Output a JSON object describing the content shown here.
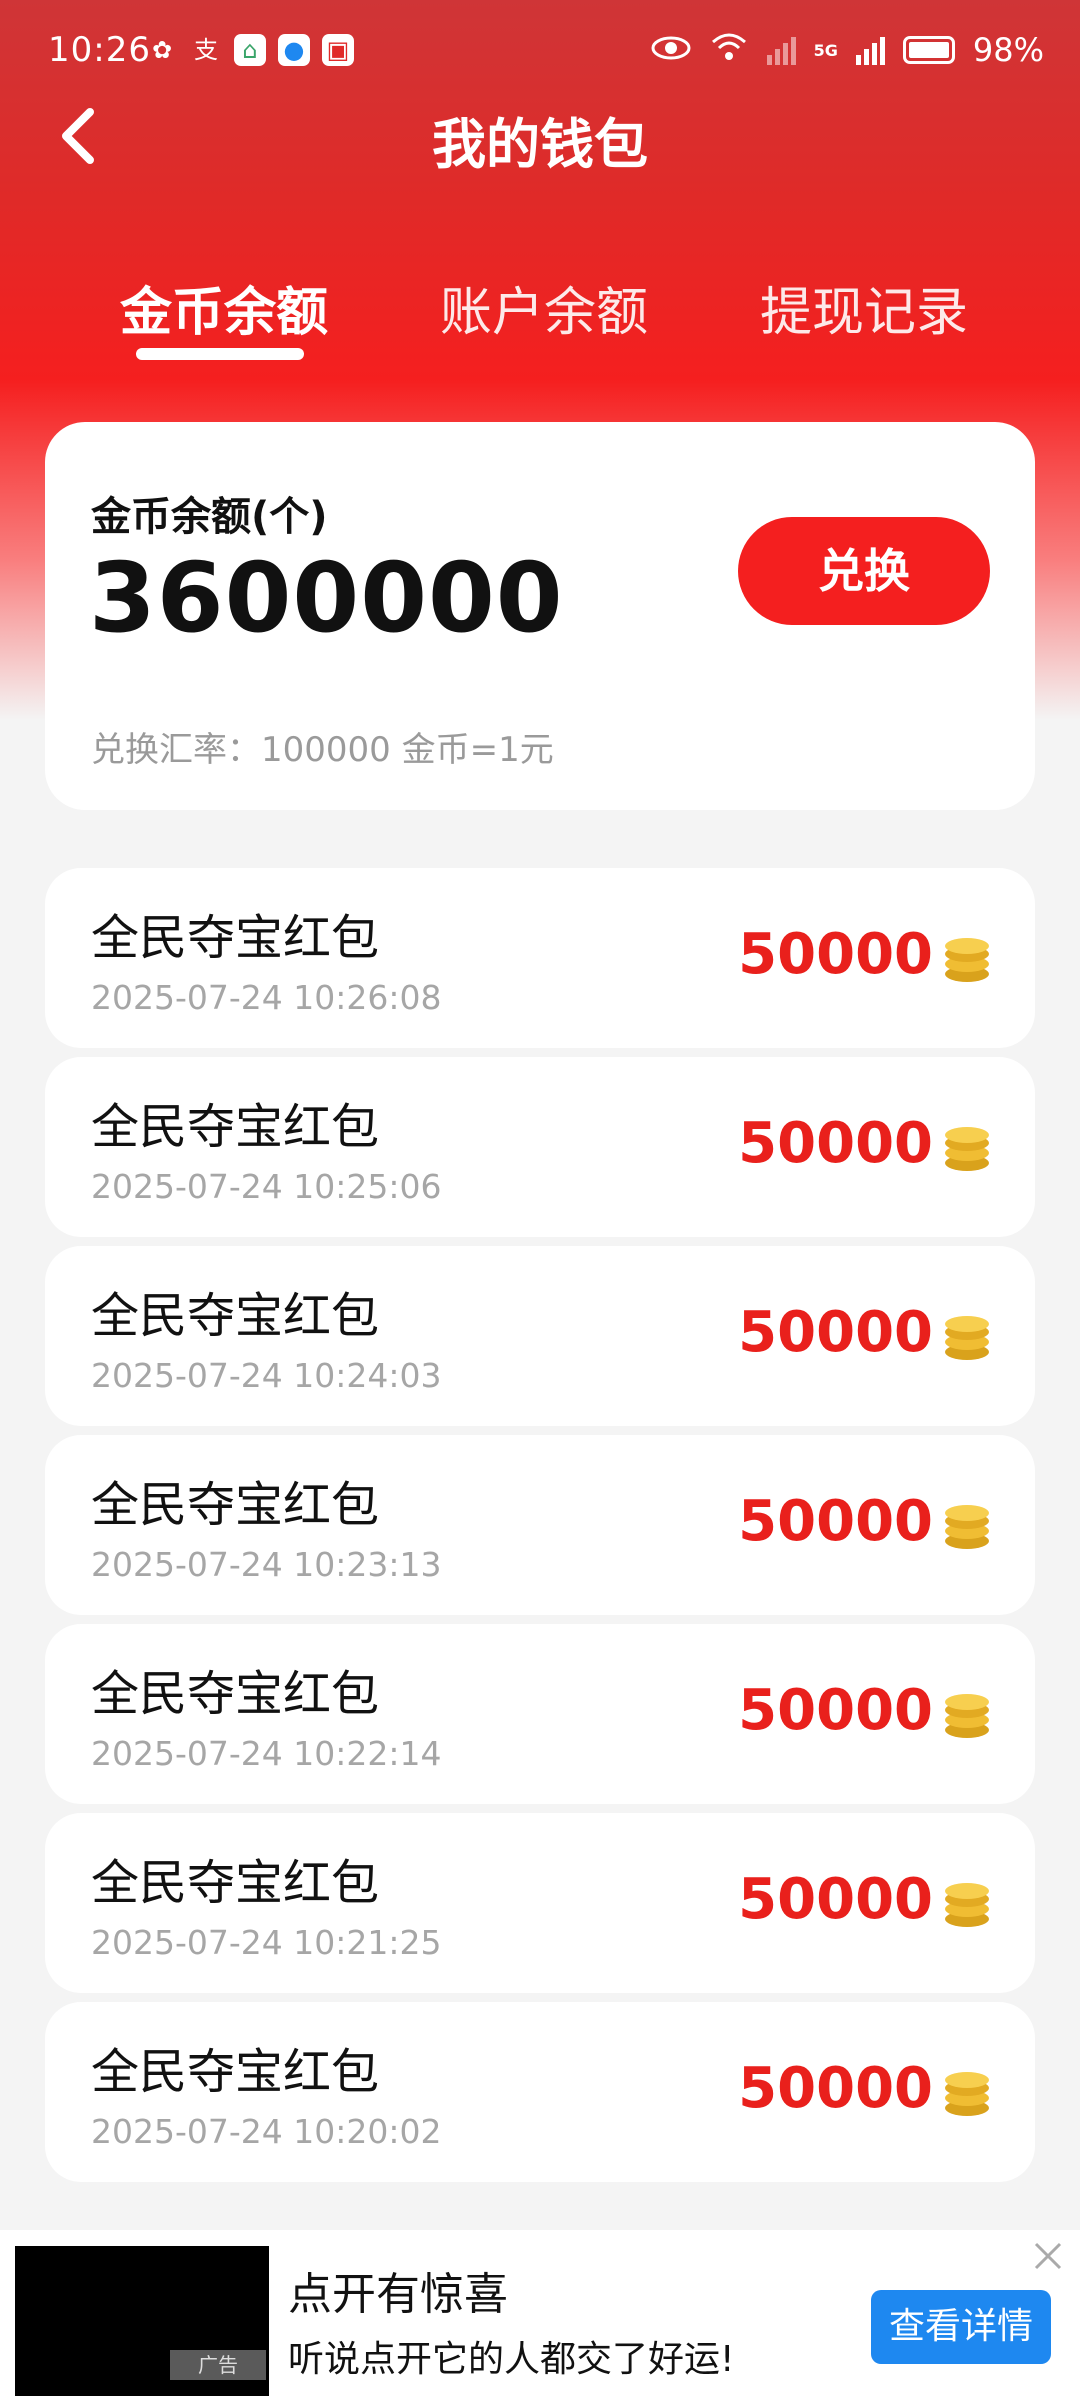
{
  "status_bar": {
    "time": "10:26",
    "battery": "98%",
    "network": "5G"
  },
  "header": {
    "title": "我的钱包"
  },
  "tabs": [
    {
      "label": "金币余额",
      "active": true
    },
    {
      "label": "账户余额",
      "active": false
    },
    {
      "label": "提现记录",
      "active": false
    }
  ],
  "balance": {
    "label": "金币余额(个)",
    "value": "3600000",
    "button_label": "兑换",
    "rate_text": "兑换汇率：100000 金币=1元"
  },
  "records": [
    {
      "title": "全民夺宝红包",
      "time": "2025-07-24 10:26:08",
      "amount": "50000"
    },
    {
      "title": "全民夺宝红包",
      "time": "2025-07-24 10:25:06",
      "amount": "50000"
    },
    {
      "title": "全民夺宝红包",
      "time": "2025-07-24 10:24:03",
      "amount": "50000"
    },
    {
      "title": "全民夺宝红包",
      "time": "2025-07-24 10:23:13",
      "amount": "50000"
    },
    {
      "title": "全民夺宝红包",
      "time": "2025-07-24 10:22:14",
      "amount": "50000"
    },
    {
      "title": "全民夺宝红包",
      "time": "2025-07-24 10:21:25",
      "amount": "50000"
    },
    {
      "title": "全民夺宝红包",
      "time": "2025-07-24 10:20:02",
      "amount": "50000"
    }
  ],
  "ad": {
    "badge": "广告",
    "title": "点开有惊喜",
    "subtitle": "听说点开它的人都交了好运!",
    "button_label": "查看详情"
  },
  "colors": {
    "brand_red": "#f41f1f",
    "amount_red": "#e9201c",
    "ad_button_blue": "#1e88f0"
  },
  "icons": {
    "record_icon": "gold-coin-stack-icon",
    "back_icon": "chevron-left-icon"
  }
}
